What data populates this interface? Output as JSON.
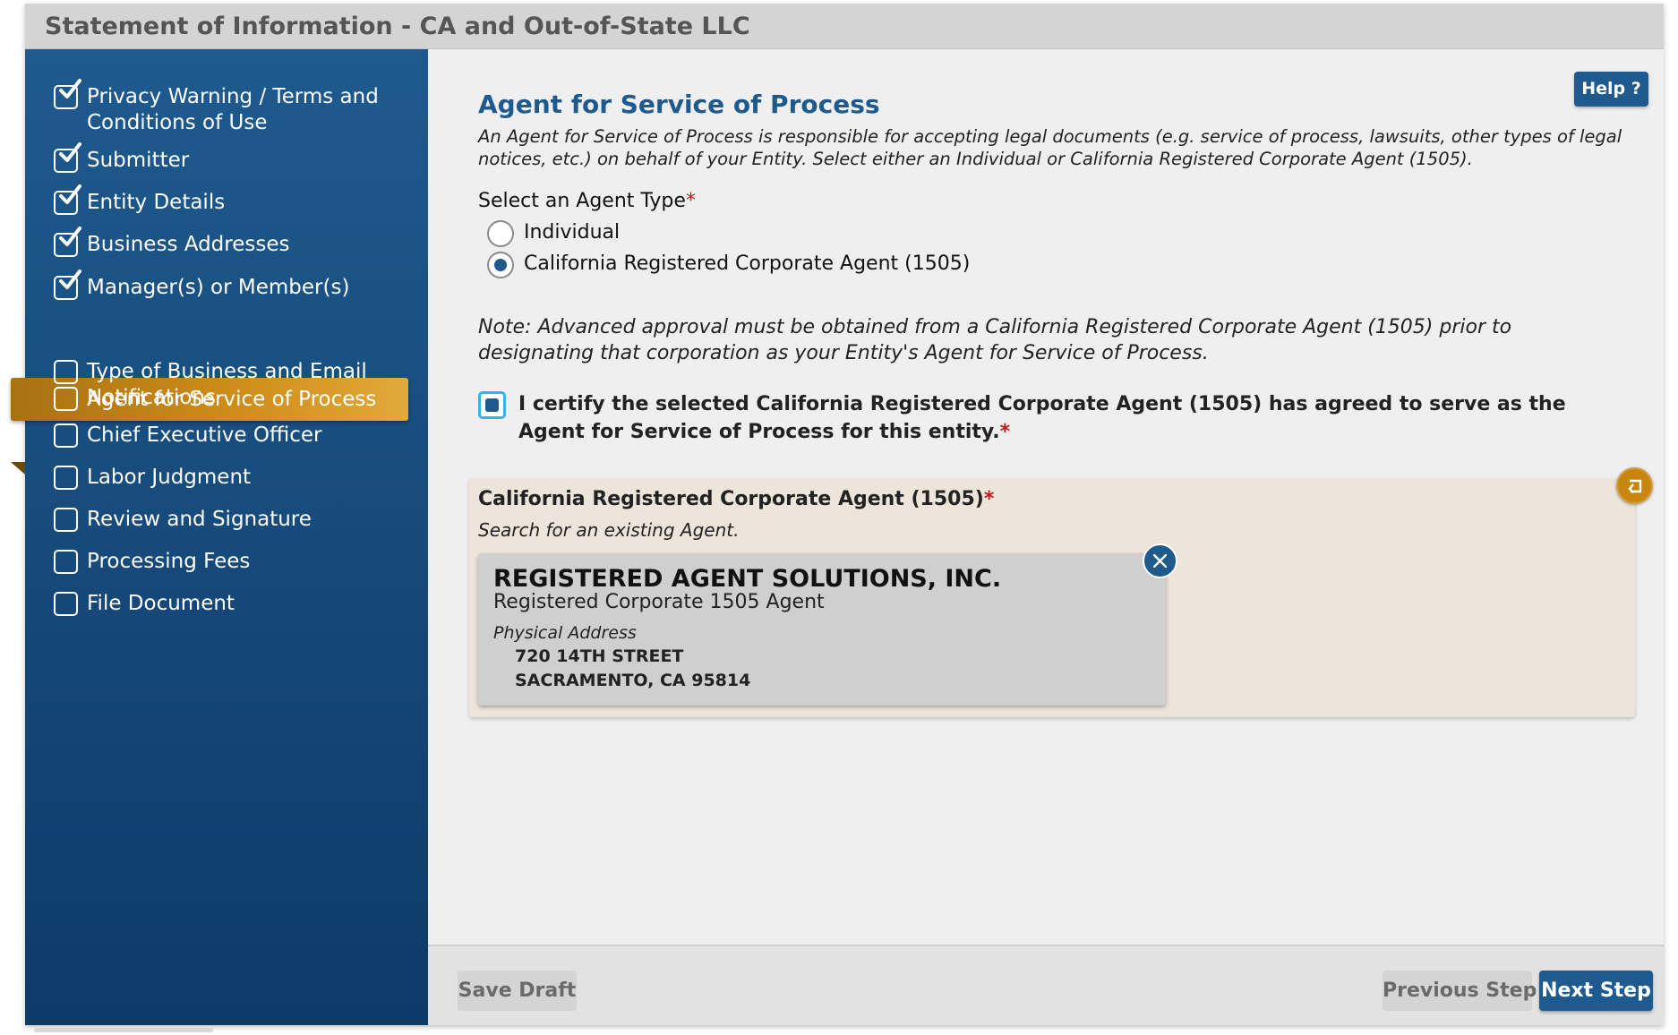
{
  "window": {
    "title": "Statement of Information - CA and Out-of-State LLC"
  },
  "sidebar": {
    "items": [
      {
        "label": "Privacy Warning / Terms and Conditions of Use",
        "completed": true,
        "active": false
      },
      {
        "label": "Submitter",
        "completed": true,
        "active": false
      },
      {
        "label": "Entity Details",
        "completed": true,
        "active": false
      },
      {
        "label": "Business Addresses",
        "completed": true,
        "active": false
      },
      {
        "label": "Manager(s) or Member(s)",
        "completed": true,
        "active": false
      },
      {
        "label": "Agent for Service of Process",
        "completed": false,
        "active": true
      },
      {
        "label": "Type of Business and Email Notifications",
        "completed": false,
        "active": false
      },
      {
        "label": "Chief Executive Officer",
        "completed": false,
        "active": false
      },
      {
        "label": "Labor Judgment",
        "completed": false,
        "active": false
      },
      {
        "label": "Review and Signature",
        "completed": false,
        "active": false
      },
      {
        "label": "Processing Fees",
        "completed": false,
        "active": false
      },
      {
        "label": "File Document",
        "completed": false,
        "active": false
      }
    ]
  },
  "main": {
    "help_label": "Help ?",
    "section_title": "Agent for Service of Process",
    "section_description": "An Agent for Service of Process is responsible for accepting legal documents (e.g. service of process, lawsuits, other types of legal notices, etc.) on behalf of your Entity. Select either an Individual or California Registered Corporate Agent (1505).",
    "agent_type": {
      "label": "Select an Agent Type",
      "required_marker": "*",
      "options": [
        {
          "label": "Individual",
          "selected": false
        },
        {
          "label": "California Registered Corporate Agent (1505)",
          "selected": true
        }
      ]
    },
    "note": "Note: Advanced approval must be obtained from a California Registered Corporate Agent (1505) prior to designating that corporation as your Entity's Agent for Service of Process.",
    "certify": {
      "checked": true,
      "text": "I certify the selected California Registered Corporate Agent (1505) has agreed to serve as the Agent for Service of Process for this entity.",
      "required_marker": "*"
    },
    "agent_panel": {
      "title": "California Registered Corporate Agent (1505)",
      "required_marker": "*",
      "subtitle": "Search for an existing Agent.",
      "selected_agent": {
        "name": "REGISTERED AGENT SOLUTIONS, INC.",
        "type": "Registered Corporate 1505 Agent",
        "address_label": "Physical Address",
        "address_line1": "720 14TH STREET",
        "address_line2": "SACRAMENTO, CA 95814"
      }
    }
  },
  "footer": {
    "save_draft_label": "Save Draft",
    "previous_step_label": "Previous Step",
    "next_step_label": "Next Step"
  },
  "colors": {
    "primary": "#1f5a8e",
    "active_nav": "#d08f1b",
    "required": "#c0171c",
    "panel_bg": "#ede4da",
    "focus_ring": "#33b3ea"
  }
}
